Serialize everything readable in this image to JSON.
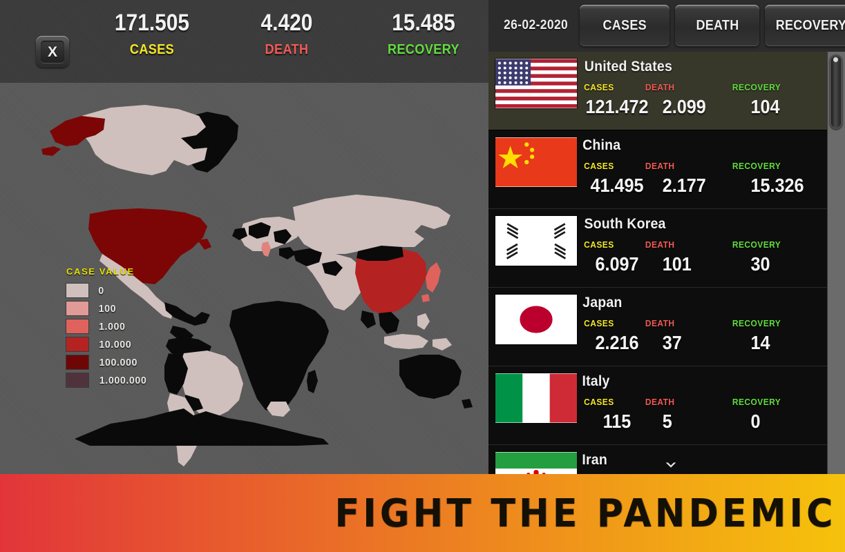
{
  "header": {
    "close_label": "X",
    "stats": [
      {
        "id": "cases",
        "value": "171.505",
        "label": "CASES",
        "color": "#f4e726"
      },
      {
        "id": "death",
        "value": "4.420",
        "label": "DEATH",
        "color": "#f25b55"
      },
      {
        "id": "recovery",
        "value": "15.485",
        "label": "RECOVERY",
        "color": "#62dd3e"
      }
    ]
  },
  "map": {
    "legend": {
      "title": "CASE VALUE",
      "entries": [
        {
          "label": "0",
          "color": "#cfc0bd"
        },
        {
          "label": "100",
          "color": "#e09a97"
        },
        {
          "label": "1.000",
          "color": "#e0625c"
        },
        {
          "label": "10.000",
          "color": "#b52222"
        },
        {
          "label": "100.000",
          "color": "#6e0606"
        },
        {
          "label": "1.000.000",
          "color": "#50323d"
        }
      ]
    },
    "colors": {
      "ocean": "#5b5b5b",
      "no_data": "#0a0a0a",
      "usa": "#7c0606",
      "canada": "#cfc0bd",
      "china": "#b52222",
      "japan": "#e0625c",
      "italy": "#e0837e",
      "default_land": "#cfc0bd"
    }
  },
  "panel": {
    "date": "26-02-2020",
    "tabs": [
      {
        "id": "cases",
        "label": "CASES"
      },
      {
        "id": "death",
        "label": "DEATH"
      },
      {
        "id": "recovery",
        "label": "RECOVERY"
      }
    ],
    "metric_labels": [
      {
        "text": "CASES",
        "color": "#f4e726"
      },
      {
        "text": "DEATH",
        "color": "#f25b55"
      },
      {
        "text": "RECOVERY",
        "color": "#62dd3e"
      }
    ],
    "rows": [
      {
        "country": "United States",
        "flag": "us",
        "selected": true,
        "cases": "121.472",
        "death": "2.099",
        "recovery": "104",
        "collapsed": false
      },
      {
        "country": "China",
        "flag": "cn",
        "selected": false,
        "cases": "41.495",
        "death": "2.177",
        "recovery": "15.326",
        "collapsed": false
      },
      {
        "country": "South Korea",
        "flag": "kr",
        "selected": false,
        "cases": "6.097",
        "death": "101",
        "recovery": "30",
        "collapsed": false
      },
      {
        "country": "Japan",
        "flag": "jp",
        "selected": false,
        "cases": "2.216",
        "death": "37",
        "recovery": "14",
        "collapsed": false
      },
      {
        "country": "Italy",
        "flag": "it",
        "selected": false,
        "cases": "115",
        "death": "5",
        "recovery": "0",
        "collapsed": false
      },
      {
        "country": "Iran",
        "flag": "ir",
        "selected": false,
        "cases": "",
        "death": "",
        "recovery": "",
        "collapsed": true
      }
    ],
    "scroll": {
      "position": "top"
    }
  },
  "banner": {
    "text": "FIGHT  THE  PANDEMIC",
    "gradient_from": "#e2353a",
    "gradient_to": "#f6c20b"
  }
}
